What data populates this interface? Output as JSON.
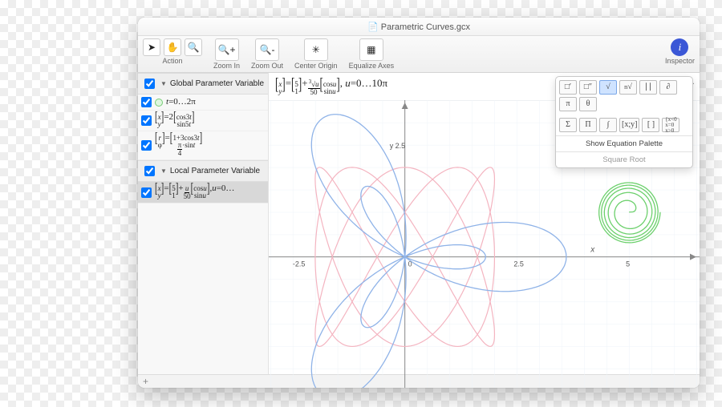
{
  "window_title": "Parametric Curves.gcx",
  "toolbar": {
    "action_label": "Action",
    "zoom_in_label": "Zoom In",
    "zoom_out_label": "Zoom Out",
    "center_label": "Center Origin",
    "equalize_label": "Equalize Axes",
    "inspector_label": "Inspector"
  },
  "sidebar": {
    "global_header": "Global Parameter Variable",
    "local_header": "Local Parameter Variable",
    "items": [
      {
        "checked": true,
        "eq": "t=0…2π"
      },
      {
        "checked": true,
        "eq": "[x;y]=2[cos3t; sin5t]"
      },
      {
        "checked": true,
        "eq": "[r;φ]=[1+3cos3t; π/4·­sin t]"
      }
    ],
    "local_items": [
      {
        "checked": true,
        "eq": "[x;y]=[5;1]+u/50[cos u; sin u], u=0…"
      }
    ]
  },
  "topstrip_eq": "[x;y]=[5;1]+³√u/50[cos u; sin u], u=0…10π",
  "legend_btn": "–Σ·",
  "popover": {
    "row1": [
      "□′",
      "□′′",
      "√",
      "ⁿ√",
      "∣∣",
      "∂",
      "π",
      "θ"
    ],
    "row2": [
      "Σ",
      "Π",
      "∫",
      "[x;y]",
      "[ ]",
      "{ x<0; x=0; x>0"
    ],
    "main_label": "Show Equation Palette",
    "sub_label": "Square Root",
    "selected_index": 2
  },
  "footer_plus": "+",
  "chart_data": {
    "type": "line",
    "title": "",
    "xlabel": "x",
    "ylabel": "y",
    "xlim": [
      -3,
      6.5
    ],
    "ylim": [
      -3,
      3
    ],
    "xticks": [
      -2.5,
      0,
      2.5,
      5
    ],
    "yticks": [
      2.5
    ],
    "series": [
      {
        "name": "lissajous_pink",
        "color": "#f6b6c2",
        "parametric": true,
        "formula": "x=2cos3t, y=2sin5t, t∈[0,2π]"
      },
      {
        "name": "rose_blue",
        "color": "#8fb3e8",
        "parametric_polar": true,
        "formula": "r=1+3cos3t, φ=(π/4)sin t, t∈[0,2π]"
      },
      {
        "name": "spiral_green",
        "color": "#7ed67e",
        "parametric": true,
        "formula": "x=5+(∛u/50)cos u, y=1+(∛u/50)sin u, u∈[0,10π]",
        "center": [
          5,
          1
        ]
      }
    ]
  }
}
